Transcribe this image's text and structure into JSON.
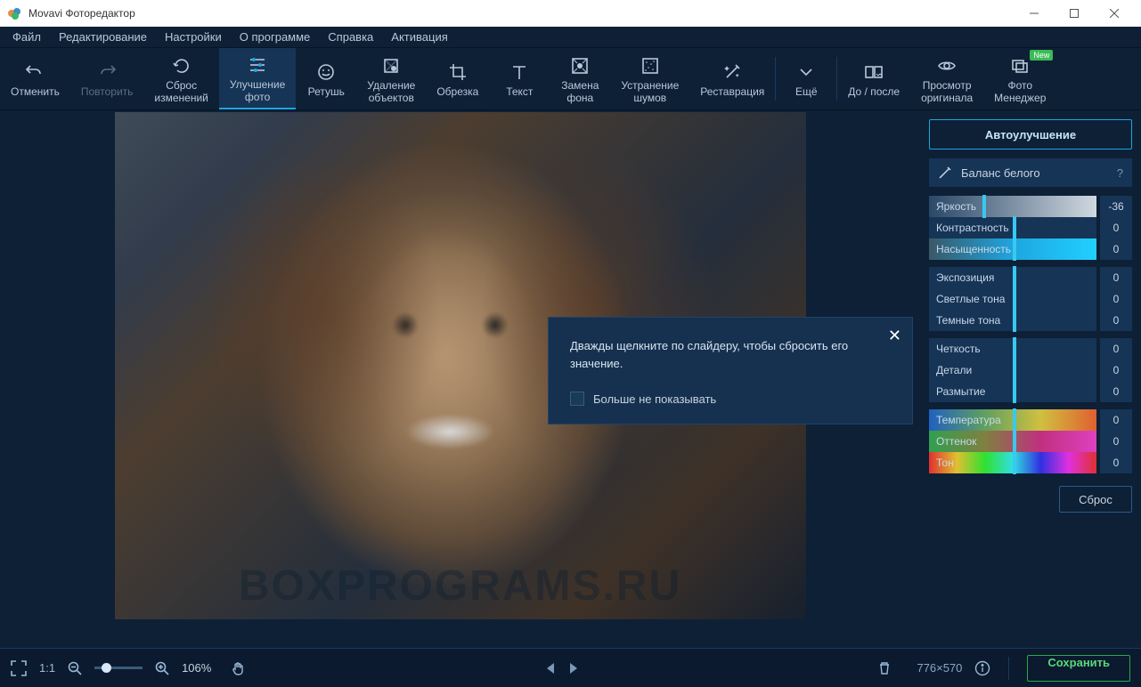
{
  "window": {
    "title": "Movavi Фоторедактор"
  },
  "menu": [
    "Файл",
    "Редактирование",
    "Настройки",
    "О программе",
    "Справка",
    "Активация"
  ],
  "toolbar": [
    {
      "id": "undo",
      "label": "Отменить",
      "icon": "undo"
    },
    {
      "id": "redo",
      "label": "Повторить",
      "icon": "redo",
      "disabled": true
    },
    {
      "id": "reset",
      "label": "Сброс\nизменений",
      "icon": "reset"
    },
    {
      "id": "enhance",
      "label": "Улучшение\nфото",
      "icon": "sliders",
      "active": true
    },
    {
      "id": "retouch",
      "label": "Ретушь",
      "icon": "face"
    },
    {
      "id": "remove",
      "label": "Удаление\nобъектов",
      "icon": "eraser"
    },
    {
      "id": "crop",
      "label": "Обрезка",
      "icon": "crop"
    },
    {
      "id": "text",
      "label": "Текст",
      "icon": "text"
    },
    {
      "id": "bg",
      "label": "Замена\nфона",
      "icon": "bg"
    },
    {
      "id": "noise",
      "label": "Устранение\nшумов",
      "icon": "noise"
    },
    {
      "id": "restore",
      "label": "Реставрация",
      "icon": "wand"
    },
    {
      "id": "more",
      "label": "Ещё",
      "icon": "chevdown",
      "sep_before": true
    },
    {
      "id": "before",
      "label": "До / после",
      "icon": "beforeafter",
      "sep_before": true
    },
    {
      "id": "orig",
      "label": "Просмотр\nоригинала",
      "icon": "eye"
    },
    {
      "id": "manager",
      "label": "Фото\nМенеджер",
      "icon": "manager",
      "badge": "New"
    }
  ],
  "popup": {
    "message": "Дважды щелкните по слайдеру, чтобы сбросить его значение.",
    "checkbox": "Больше не показывать"
  },
  "panel": {
    "auto": "Автоулучшение",
    "wb": "Баланс белого",
    "reset": "Сброс",
    "sliders": [
      {
        "id": "brightness",
        "label": "Яркость",
        "value": -36,
        "style": "gray",
        "group": 0
      },
      {
        "id": "contrast",
        "label": "Контрастность",
        "value": 0,
        "style": "plain",
        "group": 0
      },
      {
        "id": "saturation",
        "label": "Насыщенность",
        "value": 0,
        "style": "sat",
        "group": 0
      },
      {
        "id": "exposure",
        "label": "Экспозиция",
        "value": 0,
        "style": "plain",
        "group": 1
      },
      {
        "id": "highlights",
        "label": "Светлые тона",
        "value": 0,
        "style": "plain",
        "group": 1
      },
      {
        "id": "shadows",
        "label": "Темные тона",
        "value": 0,
        "style": "plain",
        "group": 1
      },
      {
        "id": "sharpness",
        "label": "Четкость",
        "value": 0,
        "style": "plain",
        "group": 2
      },
      {
        "id": "details",
        "label": "Детали",
        "value": 0,
        "style": "plain",
        "group": 2
      },
      {
        "id": "blur",
        "label": "Размытие",
        "value": 0,
        "style": "plain",
        "group": 2
      },
      {
        "id": "temperature",
        "label": "Температура",
        "value": 0,
        "style": "temp",
        "group": 3
      },
      {
        "id": "tint",
        "label": "Оттенок",
        "value": 0,
        "style": "tint",
        "group": 3
      },
      {
        "id": "hue",
        "label": "Тон",
        "value": 0,
        "style": "hue",
        "group": 3
      }
    ]
  },
  "bottom": {
    "fit_label": "1:1",
    "zoom": "106%",
    "dimensions": "776×570",
    "save": "Сохранить"
  },
  "watermark": "BOXPROGRAMS.RU"
}
